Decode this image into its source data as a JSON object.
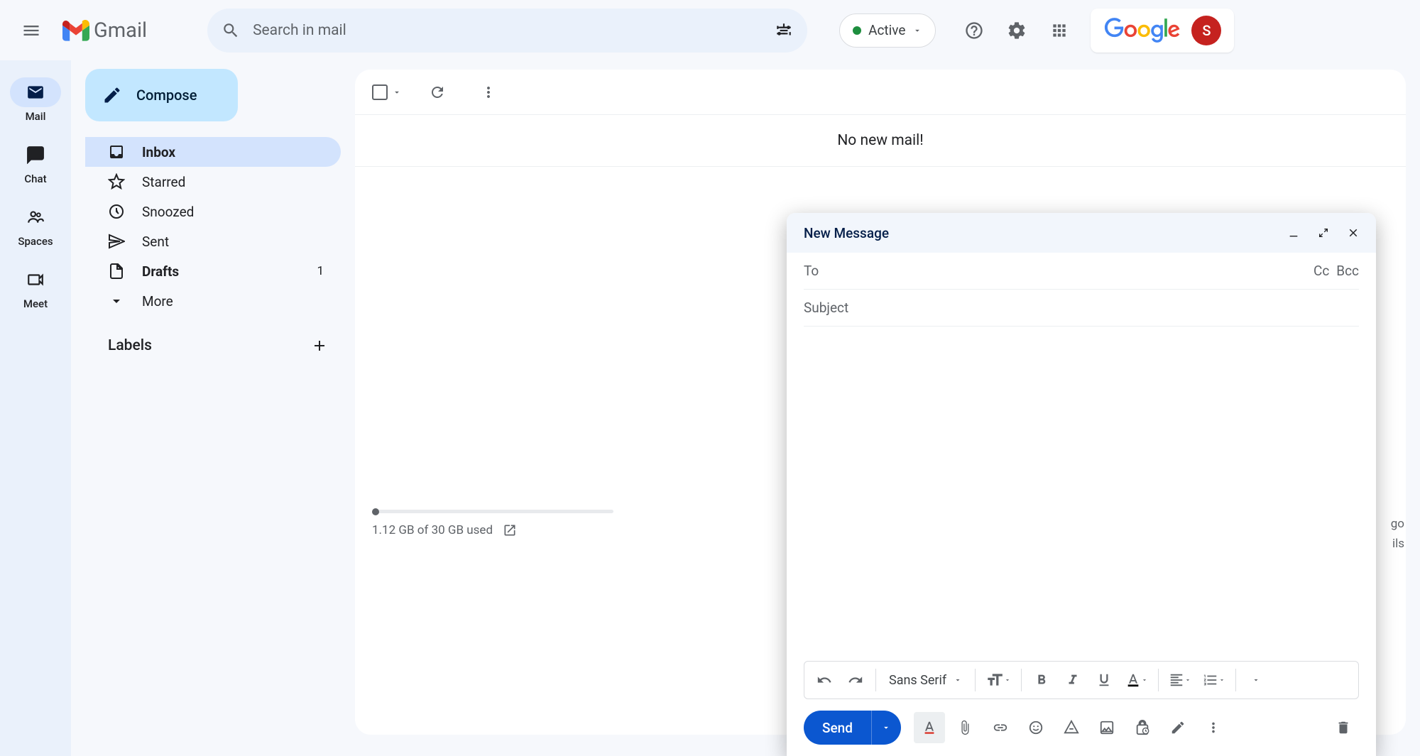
{
  "header": {
    "app_name": "Gmail",
    "search_placeholder": "Search in mail",
    "status_label": "Active",
    "google_text": "Google",
    "avatar_initial": "S"
  },
  "rail": {
    "items": [
      {
        "label": "Mail"
      },
      {
        "label": "Chat"
      },
      {
        "label": "Spaces"
      },
      {
        "label": "Meet"
      }
    ]
  },
  "sidebar": {
    "compose_label": "Compose",
    "items": [
      {
        "label": "Inbox",
        "count": ""
      },
      {
        "label": "Starred",
        "count": ""
      },
      {
        "label": "Snoozed",
        "count": ""
      },
      {
        "label": "Sent",
        "count": ""
      },
      {
        "label": "Drafts",
        "count": "1"
      },
      {
        "label": "More",
        "count": ""
      }
    ],
    "labels_title": "Labels"
  },
  "main": {
    "empty_message": "No new mail!"
  },
  "storage": {
    "text": "1.12 GB of 30 GB used"
  },
  "footer_right": {
    "line1_tail": "go",
    "line2_tail": "ils"
  },
  "compose": {
    "title": "New Message",
    "to_label": "To",
    "cc": "Cc",
    "bcc": "Bcc",
    "subject_placeholder": "Subject",
    "font": "Sans Serif",
    "send_label": "Send"
  }
}
